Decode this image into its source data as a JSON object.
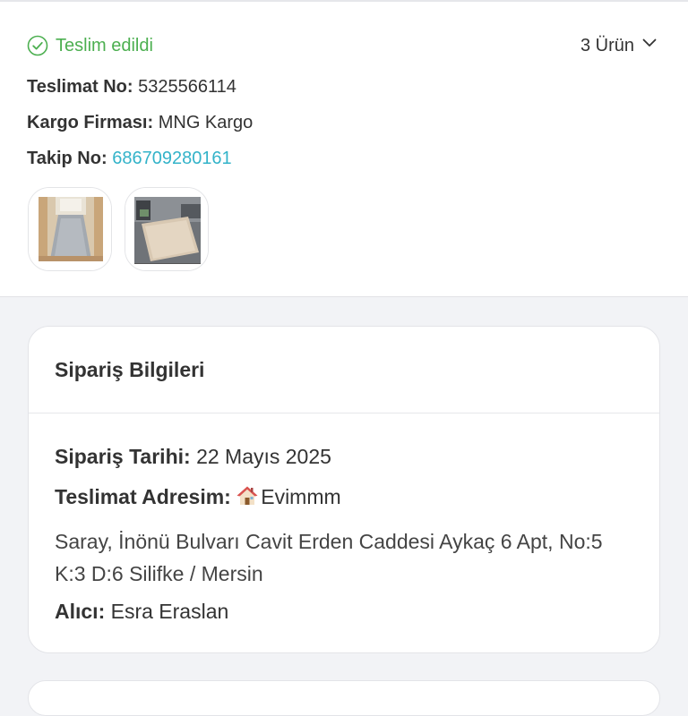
{
  "shipment": {
    "status": "Teslim edildi",
    "items_count": "3 Ürün",
    "delivery_no_label": "Teslimat No:",
    "delivery_no": "5325566114",
    "carrier_label": "Kargo Firması:",
    "carrier": "MNG Kargo",
    "tracking_label": "Takip No:",
    "tracking_no": "686709280161",
    "status_color": "#4caf50",
    "link_color": "#33b3c9",
    "thumbnails": [
      "hallway-rug-thumbnail",
      "living-room-rug-thumbnail"
    ]
  },
  "order_info": {
    "title": "Sipariş Bilgileri",
    "date_label": "Sipariş Tarihi:",
    "date": "22 Mayıs 2025",
    "address_label": "Teslimat Adresim:",
    "address_name": "Evimmm",
    "address_icon": "house-icon",
    "address_text": "Saray, İnönü Bulvarı Cavit Erden Caddesi Aykaç 6 Apt, No:5 K:3 D:6 Silifke / Mersin",
    "recipient_label": "Alıcı:",
    "recipient": "Esra Eraslan"
  }
}
